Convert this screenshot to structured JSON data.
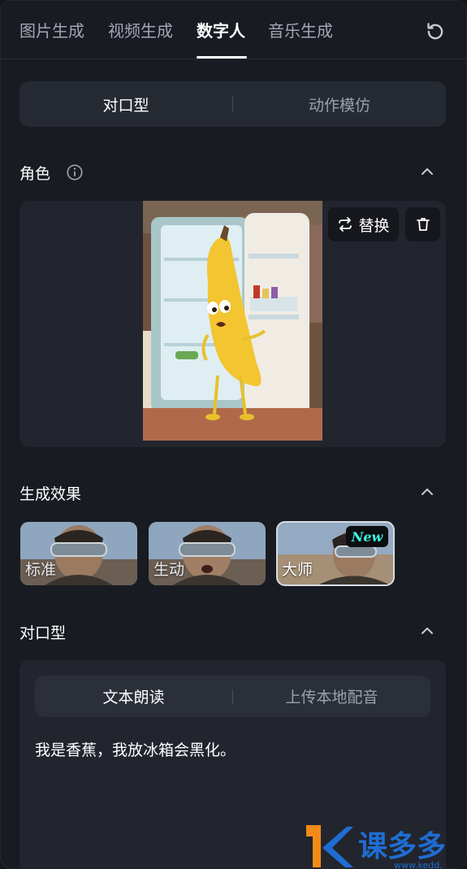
{
  "top_tabs": [
    "图片生成",
    "视频生成",
    "数字人",
    "音乐生成"
  ],
  "mode_switch": {
    "lipsync": "对口型",
    "motion": "动作模仿"
  },
  "character": {
    "title": "角色",
    "replace_label": "替换"
  },
  "effects": {
    "title": "生成效果",
    "items": [
      {
        "label": "标准"
      },
      {
        "label": "生动"
      },
      {
        "label": "大师",
        "badge": "New"
      }
    ]
  },
  "lipsync": {
    "title": "对口型",
    "tabs": {
      "read": "文本朗读",
      "upload": "上传本地配音"
    },
    "text": "我是香蕉，我放冰箱会黑化。"
  },
  "watermark": {
    "brand": "课多多",
    "url": "www.kedd."
  },
  "colors": {
    "accent_new": "#3ef3e3",
    "panel": "#181b22",
    "card": "#22252e"
  }
}
